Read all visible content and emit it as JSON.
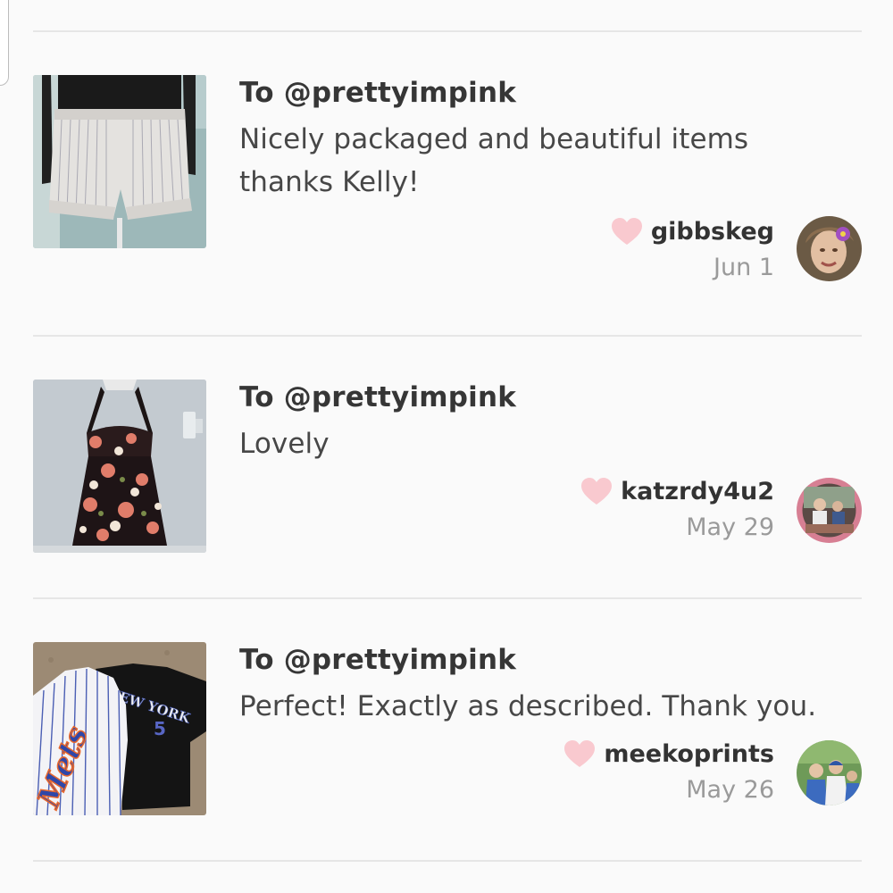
{
  "reviews": [
    {
      "to": "To @prettyimpink",
      "comment": "Nicely packaged and beautiful items thanks Kelly!",
      "username": "gibbskeg",
      "date": "Jun 1",
      "product_icon": "shorts-photo",
      "avatar_icon": "user-avatar-photo"
    },
    {
      "to": "To @prettyimpink",
      "comment": "Lovely",
      "username": "katzrdy4u2",
      "date": "May 29",
      "product_icon": "dress-photo",
      "avatar_icon": "user-avatar-photo"
    },
    {
      "to": "To @prettyimpink",
      "comment": "Perfect! Exactly as described. Thank you.",
      "username": "meekoprints",
      "date": "May 26",
      "product_icon": "jersey-photo",
      "avatar_icon": "user-avatar-photo"
    }
  ],
  "jersey_text": {
    "team": "Mets",
    "city": "NEW YORK",
    "number": "5"
  },
  "colors": {
    "heart": "#f9c9cf",
    "divider": "#e6e6e6",
    "date": "#9a9a9a"
  }
}
